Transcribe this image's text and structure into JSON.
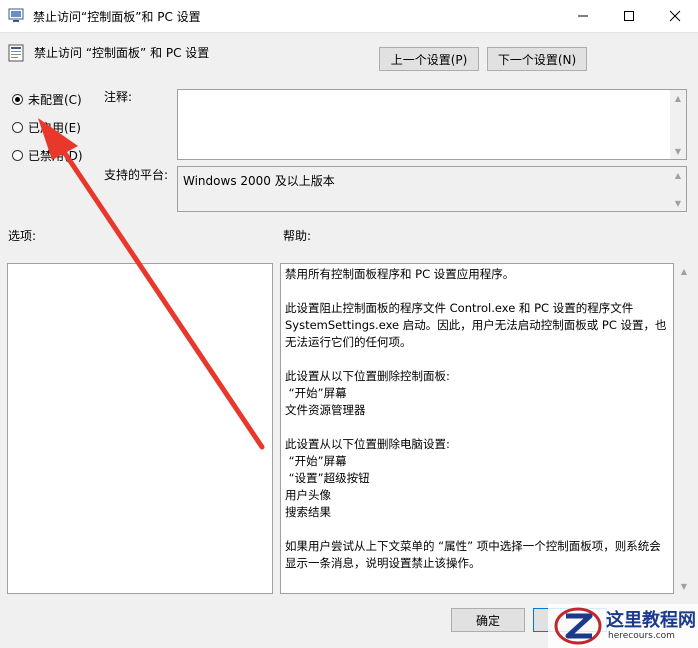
{
  "window": {
    "title": "禁止访问“控制面板”和 PC 设置"
  },
  "header": {
    "policy_name": "禁止访问 “控制面板” 和 PC 设置",
    "prev_button": "上一个设置(P)",
    "next_button": "下一个设置(N)"
  },
  "state": {
    "not_configured": "未配置(C)",
    "enabled": "已启用(E)",
    "disabled": "已禁用(D)",
    "selected": "not_configured"
  },
  "comment": {
    "label": "注释:",
    "value": ""
  },
  "platform": {
    "label": "支持的平台:",
    "value": "Windows 2000 及以上版本"
  },
  "options": {
    "label": "选项:"
  },
  "help": {
    "label": "帮助:",
    "text": "禁用所有控制面板程序和 PC 设置应用程序。\n\n此设置阻止控制面板的程序文件 Control.exe 和 PC 设置的程序文件 SystemSettings.exe 启动。因此，用户无法启动控制面板或 PC 设置，也无法运行它们的任何项。\n\n此设置从以下位置删除控制面板:\n “开始”屏幕\n文件资源管理器\n\n此设置从以下位置删除电脑设置:\n “开始”屏幕\n “设置”超级按钮\n用户头像\n搜索结果\n\n如果用户尝试从上下文菜单的 “属性” 项中选择一个控制面板项，则系统会显示一条消息，说明设置禁止该操作。"
  },
  "footer": {
    "ok_button": "确定"
  },
  "watermark": {
    "name": "这里教程网",
    "url": "herecours.com"
  },
  "colors": {
    "annotation_arrow": "#e8382b",
    "watermark_blue": "#1a3a8a"
  }
}
